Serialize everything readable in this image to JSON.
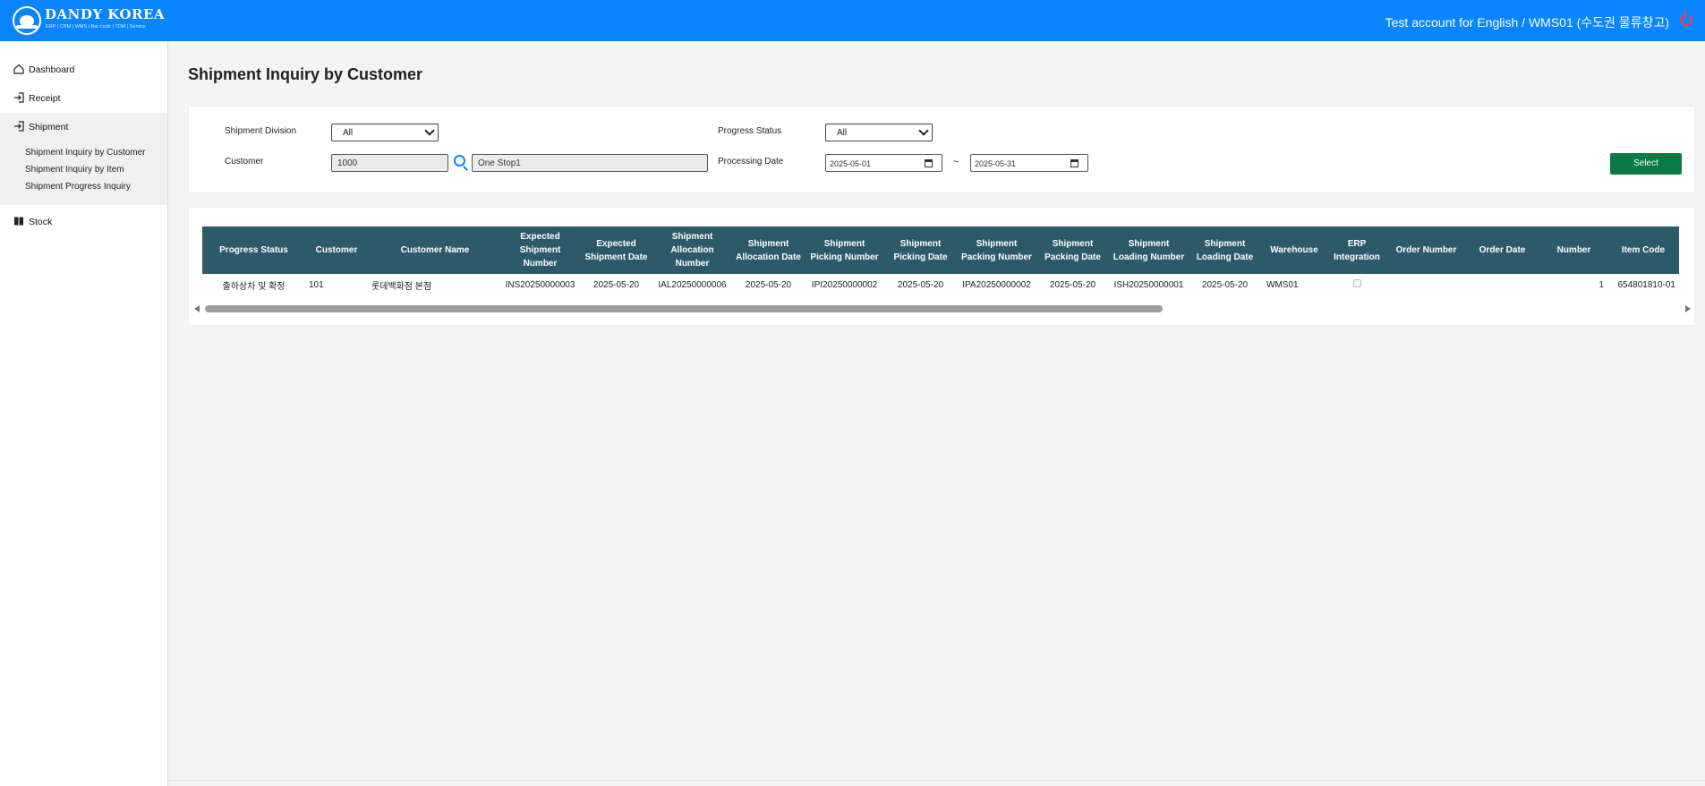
{
  "header": {
    "brand": "DANDY KOREA",
    "tagline": "ERP | CRM | WMS | Bar-code | TDM | Service",
    "user_info": "Test account for English / WMS01 (수도권 물류창고)"
  },
  "sidebar": {
    "items": [
      {
        "label": "Dashboard",
        "icon": "home-icon"
      },
      {
        "label": "Receipt",
        "icon": "sign-in-icon"
      },
      {
        "label": "Shipment",
        "icon": "sign-in-icon"
      },
      {
        "label": "Stock",
        "icon": "book-icon"
      }
    ],
    "shipment_submenu": [
      "Shipment Inquiry by Customer",
      "Shipment Inquiry by Item",
      "Shipment Progress Inquiry"
    ]
  },
  "page": {
    "title": "Shipment Inquiry by Customer"
  },
  "filters": {
    "shipment_division_label": "Shipment Division",
    "shipment_division_value": "All",
    "progress_status_label": "Progress Status",
    "progress_status_value": "All",
    "customer_label": "Customer",
    "customer_code": "1000",
    "customer_name": "One Stop1",
    "processing_date_label": "Processing Date",
    "date_from": "2025-05-01",
    "date_sep": "~",
    "date_to": "2025-05-31",
    "select_button": "Select"
  },
  "grid": {
    "columns": [
      "Progress Status",
      "Customer",
      "Customer Name",
      "Expected Shipment Number",
      "Expected Shipment Date",
      "Shipment Allocation Number",
      "Shipment Allocation Date",
      "Shipment Picking Number",
      "Shipment Picking Date",
      "Shipment Packing Number",
      "Shipment Packing Date",
      "Shipment Loading Number",
      "Shipment Loading Date",
      "Warehouse",
      "ERP Integration",
      "Order Number",
      "Order Date",
      "Number",
      "Item Code"
    ],
    "rows": [
      {
        "progress_status": "출하상차 및 확정",
        "customer": "101",
        "customer_name": "롯데백화점 본점",
        "expected_shipment_number": "INS20250000003",
        "expected_shipment_date": "2025-05-20",
        "allocation_number": "IAL20250000006",
        "allocation_date": "2025-05-20",
        "picking_number": "IPI20250000002",
        "picking_date": "2025-05-20",
        "packing_number": "IPA20250000002",
        "packing_date": "2025-05-20",
        "loading_number": "ISH20250000001",
        "loading_date": "2025-05-20",
        "warehouse": "WMS01",
        "erp_integration": false,
        "order_number": "",
        "order_date": "",
        "number": "1",
        "item_code": "654801810-01"
      }
    ],
    "scroll_position": 0.0,
    "scroll_visible_fraction": 0.64
  }
}
